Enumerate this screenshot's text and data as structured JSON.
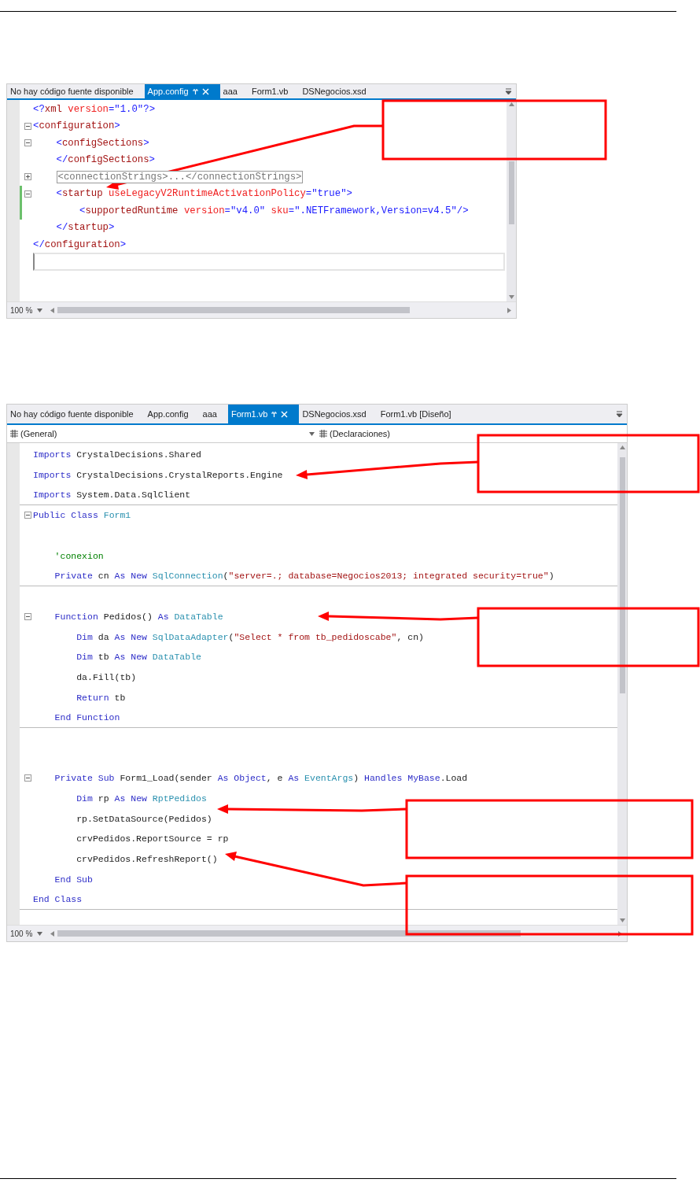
{
  "documents": [
    {
      "tabs": [
        {
          "label": "No hay código fuente disponible",
          "selected": false
        },
        {
          "label": "App.config",
          "selected": true
        },
        {
          "label": "aaa",
          "selected": false
        },
        {
          "label": "Form1.vb",
          "selected": false
        },
        {
          "label": "DSNegocios.xsd",
          "selected": false
        }
      ],
      "code": [
        {
          "changed": false,
          "current": false,
          "tokens": [
            {
              "kind": "xml-delim",
              "text": "<?"
            },
            {
              "kind": "xml-tag",
              "text": "xml"
            },
            {
              "kind": "xml-attr",
              "text": " version"
            },
            {
              "kind": "xml-delim",
              "text": "="
            },
            {
              "kind": "xml-value",
              "text": "\"1.0\""
            },
            {
              "kind": "xml-delim",
              "text": "?>"
            }
          ]
        },
        {
          "expanded": true,
          "changed": false,
          "current": false,
          "tokens": [
            {
              "kind": "xml-delim",
              "text": "<"
            },
            {
              "kind": "xml-tag",
              "text": "configuration"
            },
            {
              "kind": "xml-delim",
              "text": ">"
            }
          ]
        },
        {
          "expanded": true,
          "changed": false,
          "current": false,
          "tokens": [
            {
              "kind": "xml-delim",
              "text": "    <"
            },
            {
              "kind": "xml-tag",
              "text": "configSections"
            },
            {
              "kind": "xml-delim",
              "text": ">"
            }
          ]
        },
        {
          "changed": false,
          "current": false,
          "tokens": [
            {
              "kind": "xml-delim",
              "text": "    </"
            },
            {
              "kind": "xml-tag",
              "text": "configSections"
            },
            {
              "kind": "xml-delim",
              "text": ">"
            }
          ]
        },
        {
          "expanded": false,
          "changed": false,
          "current": false,
          "tokens": [
            {
              "kind": "collapsed",
              "text": "    <connectionStrings>...</connectionStrings>"
            }
          ]
        },
        {
          "expanded": true,
          "changed": true,
          "current": false,
          "tokens": [
            {
              "kind": "xml-delim",
              "text": "    <"
            },
            {
              "kind": "xml-tag",
              "text": "startup"
            },
            {
              "kind": "xml-attr",
              "text": " useLegacyV2RuntimeActivationPolicy"
            },
            {
              "kind": "xml-delim",
              "text": "="
            },
            {
              "kind": "xml-value",
              "text": "\"true\""
            },
            {
              "kind": "xml-delim",
              "text": ">"
            }
          ]
        },
        {
          "changed": true,
          "current": false,
          "tokens": [
            {
              "kind": "xml-delim",
              "text": "        <"
            },
            {
              "kind": "xml-tag",
              "text": "supportedRuntime"
            },
            {
              "kind": "xml-attr",
              "text": " version"
            },
            {
              "kind": "xml-delim",
              "text": "="
            },
            {
              "kind": "xml-value",
              "text": "\"v4.0\""
            },
            {
              "kind": "xml-attr",
              "text": " sku"
            },
            {
              "kind": "xml-delim",
              "text": "="
            },
            {
              "kind": "xml-value",
              "text": "\".NETFramework,Version=v4.5\""
            },
            {
              "kind": "xml-delim",
              "text": "/>"
            }
          ]
        },
        {
          "changed": false,
          "current": false,
          "tokens": [
            {
              "kind": "xml-delim",
              "text": "    </"
            },
            {
              "kind": "xml-tag",
              "text": "startup"
            },
            {
              "kind": "xml-delim",
              "text": ">"
            }
          ]
        },
        {
          "changed": false,
          "current": false,
          "tokens": [
            {
              "kind": "xml-delim",
              "text": "</"
            },
            {
              "kind": "xml-tag",
              "text": "configuration"
            },
            {
              "kind": "xml-delim",
              "text": ">"
            }
          ]
        },
        {
          "changed": false,
          "current": true
        }
      ],
      "zoom": "100 %"
    },
    {
      "tabs": [
        {
          "label": "No hay código fuente disponible",
          "selected": false
        },
        {
          "label": "App.config",
          "selected": false
        },
        {
          "label": "aaa",
          "selected": false
        },
        {
          "label": "Form1.vb",
          "selected": true
        },
        {
          "label": "DSNegocios.xsd",
          "selected": false
        },
        {
          "label": "Form1.vb [Diseño]",
          "selected": false
        }
      ],
      "dropdowns": [
        "(General)",
        "(Declaraciones)"
      ],
      "code": [
        {
          "separator": false,
          "tokens": [
            {
              "kind": "keyword",
              "text": "Imports"
            },
            {
              "kind": "plain",
              "text": " CrystalDecisions.Shared"
            }
          ]
        },
        {
          "separator": false,
          "tokens": [
            {
              "kind": "keyword",
              "text": "Imports"
            },
            {
              "kind": "plain",
              "text": " CrystalDecisions.CrystalReports.Engine"
            }
          ]
        },
        {
          "separator": true,
          "tokens": [
            {
              "kind": "keyword",
              "text": "Imports"
            },
            {
              "kind": "plain",
              "text": " System.Data.SqlClient"
            }
          ]
        },
        {
          "expanded": true,
          "separator": false,
          "tokens": [
            {
              "kind": "keyword",
              "text": "Public Class"
            },
            {
              "kind": "type",
              "text": " Form1"
            }
          ]
        },
        {
          "separator": false
        },
        {
          "separator": false,
          "tokens": [
            {
              "kind": "comment",
              "text": "    'conexion"
            }
          ]
        },
        {
          "separator": true,
          "tokens": [
            {
              "kind": "keyword",
              "text": "    Private"
            },
            {
              "kind": "plain",
              "text": " cn "
            },
            {
              "kind": "keyword",
              "text": "As New"
            },
            {
              "kind": "type",
              "text": " SqlConnection"
            },
            {
              "kind": "plain",
              "text": "("
            },
            {
              "kind": "string",
              "text": "\"server=.; database=Negocios2013; integrated security=true\""
            },
            {
              "kind": "plain",
              "text": ")"
            }
          ]
        },
        {
          "separator": false
        },
        {
          "expanded": true,
          "separator": false,
          "tokens": [
            {
              "kind": "keyword",
              "text": "    Function"
            },
            {
              "kind": "plain",
              "text": " Pedidos() "
            },
            {
              "kind": "keyword",
              "text": "As"
            },
            {
              "kind": "type",
              "text": " DataTable"
            }
          ]
        },
        {
          "separator": false,
          "tokens": [
            {
              "kind": "keyword",
              "text": "        Dim"
            },
            {
              "kind": "plain",
              "text": " da "
            },
            {
              "kind": "keyword",
              "text": "As New"
            },
            {
              "kind": "type",
              "text": " SqlDataAdapter"
            },
            {
              "kind": "plain",
              "text": "("
            },
            {
              "kind": "string",
              "text": "\"Select * from tb_pedidoscabe\""
            },
            {
              "kind": "plain",
              "text": ", cn)"
            }
          ]
        },
        {
          "separator": false,
          "tokens": [
            {
              "kind": "keyword",
              "text": "        Dim"
            },
            {
              "kind": "plain",
              "text": " tb "
            },
            {
              "kind": "keyword",
              "text": "As New"
            },
            {
              "kind": "type",
              "text": " DataTable"
            }
          ]
        },
        {
          "separator": false,
          "tokens": [
            {
              "kind": "plain",
              "text": "        da.Fill(tb)"
            }
          ]
        },
        {
          "separator": false,
          "tokens": [
            {
              "kind": "keyword",
              "text": "        Return"
            },
            {
              "kind": "plain",
              "text": " tb"
            }
          ]
        },
        {
          "separator": true,
          "tokens": [
            {
              "kind": "keyword",
              "text": "    End Function"
            }
          ]
        },
        {
          "separator": false
        },
        {
          "separator": false
        },
        {
          "expanded": true,
          "separator": false,
          "tokens": [
            {
              "kind": "keyword",
              "text": "    Private Sub"
            },
            {
              "kind": "plain",
              "text": " Form1_Load(sender "
            },
            {
              "kind": "keyword",
              "text": "As Object"
            },
            {
              "kind": "plain",
              "text": ", e "
            },
            {
              "kind": "keyword",
              "text": "As"
            },
            {
              "kind": "type",
              "text": " EventArgs"
            },
            {
              "kind": "plain",
              "text": ") "
            },
            {
              "kind": "keyword",
              "text": "Handles MyBase"
            },
            {
              "kind": "plain",
              "text": ".Load"
            }
          ]
        },
        {
          "separator": false,
          "tokens": [
            {
              "kind": "keyword",
              "text": "        Dim"
            },
            {
              "kind": "plain",
              "text": " rp "
            },
            {
              "kind": "keyword",
              "text": "As New"
            },
            {
              "kind": "type",
              "text": " RptPedidos"
            }
          ]
        },
        {
          "separator": false,
          "tokens": [
            {
              "kind": "plain",
              "text": "        rp.SetDataSource(Pedidos)"
            }
          ]
        },
        {
          "separator": false,
          "tokens": [
            {
              "kind": "plain",
              "text": "        crvPedidos.ReportSource = rp"
            }
          ]
        },
        {
          "separator": false,
          "tokens": [
            {
              "kind": "plain",
              "text": "        crvPedidos.RefreshReport()"
            }
          ]
        },
        {
          "separator": false,
          "tokens": [
            {
              "kind": "keyword",
              "text": "    End Sub"
            }
          ]
        },
        {
          "separator": true,
          "tokens": [
            {
              "kind": "keyword",
              "text": "End Class"
            }
          ]
        }
      ],
      "zoom": "100 %"
    }
  ]
}
